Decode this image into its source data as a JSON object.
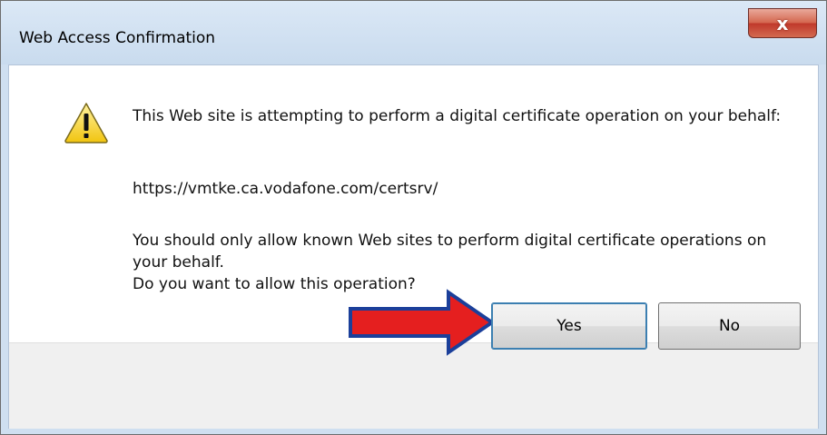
{
  "window": {
    "title": "Web Access Confirmation",
    "close_label": "x"
  },
  "dialog": {
    "message_line1": "This Web site is attempting to perform a digital certificate operation on your behalf:",
    "url": "https://vmtke.ca.vodafone.com/certsrv/",
    "message_line2": "You should only allow known Web sites to perform digital certificate operations on your behalf.",
    "question": "Do you want to allow this operation?"
  },
  "buttons": {
    "yes_label": "Yes",
    "no_label": "No"
  },
  "icons": {
    "warning": "warning-icon",
    "annotation_arrow": "arrow-right-icon"
  },
  "colors": {
    "warning_yellow": "#f6d02c",
    "arrow_red": "#e51f1f",
    "close_red": "#c0392b"
  }
}
